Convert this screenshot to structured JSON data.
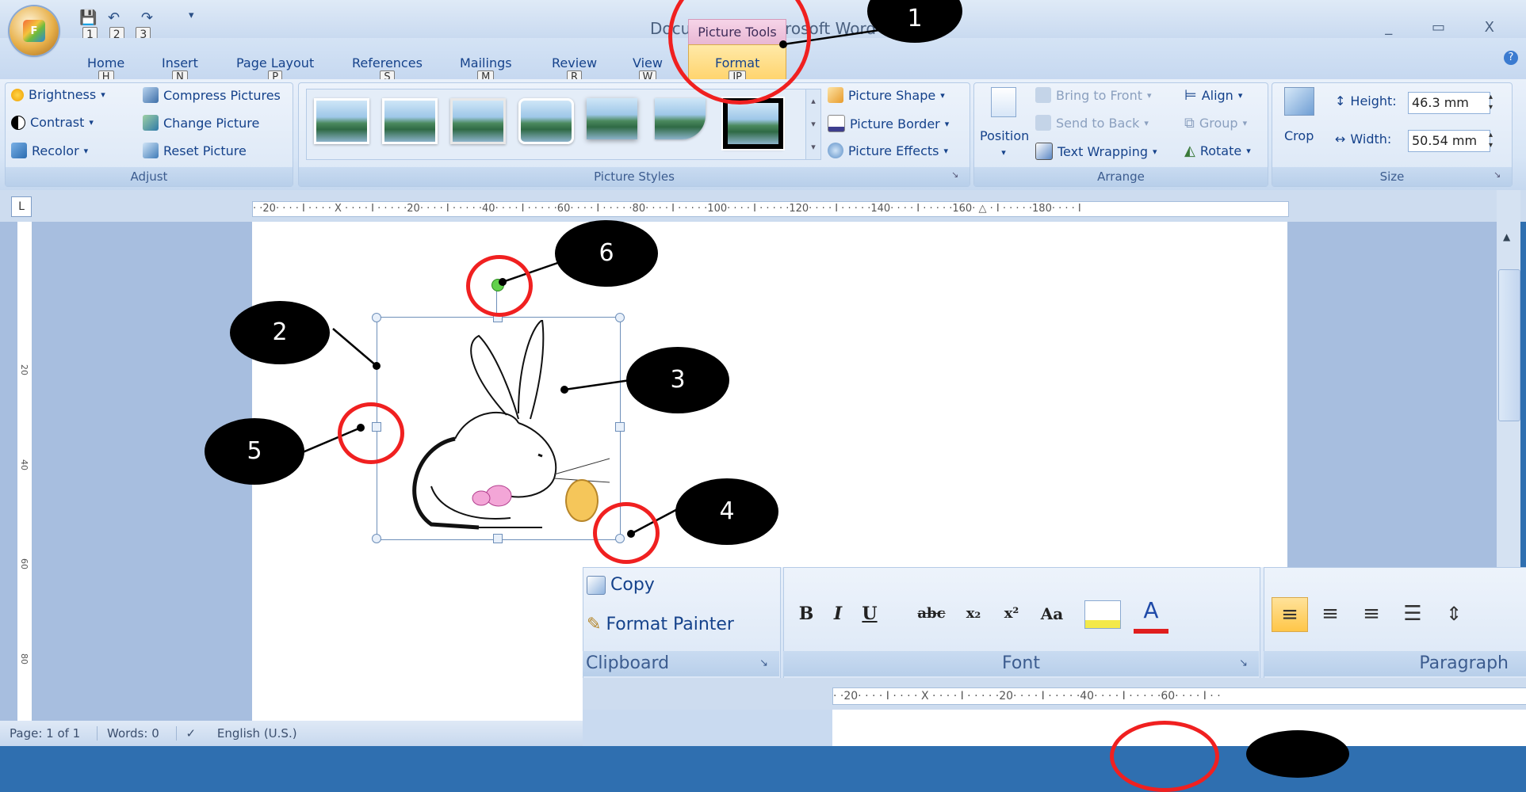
{
  "window": {
    "title": "Document1 - Microsoft Word",
    "controls": "_ ▭ X"
  },
  "office_button": {
    "logo": "F"
  },
  "qat": {
    "keytips": [
      "1",
      "2",
      "3"
    ]
  },
  "tabs": [
    {
      "label": "Home",
      "key": "H"
    },
    {
      "label": "Insert",
      "key": "N"
    },
    {
      "label": "Page Layout",
      "key": "P"
    },
    {
      "label": "References",
      "key": "S"
    },
    {
      "label": "Mailings",
      "key": "M"
    },
    {
      "label": "Review",
      "key": "R"
    },
    {
      "label": "View",
      "key": "W"
    },
    {
      "label": "Format",
      "key": "JP"
    }
  ],
  "contextual_tab": "Picture Tools",
  "ribbon": {
    "adjust": {
      "label": "Adjust",
      "brightness": "Brightness",
      "contrast": "Contrast",
      "recolor": "Recolor",
      "compress": "Compress Pictures",
      "change": "Change Picture",
      "reset": "Reset Picture"
    },
    "picture_styles": {
      "label": "Picture Styles",
      "shape": "Picture Shape",
      "border": "Picture Border",
      "effects": "Picture Effects"
    },
    "arrange": {
      "label": "Arrange",
      "position": "Position",
      "bring_front": "Bring to Front",
      "send_back": "Send to Back",
      "text_wrap": "Text Wrapping",
      "align": "Align",
      "group": "Group",
      "rotate": "Rotate"
    },
    "size": {
      "label": "Size",
      "crop": "Crop",
      "height_label": "Height:",
      "height_value": "46.3 mm",
      "width_label": "Width:",
      "width_value": "50.54 mm"
    }
  },
  "ruler": {
    "ticks": "· ·20· · · · I · · · · X · · · · I · · · · ·20· · · · I · · · · ·40· · · · I · · · · ·60· · · · I · · · · ·80· · · · I · · · · ·100· · · · I · · · · ·120· · · · I · · · · ·140· · · · I · · · · ·160· △ · I · · · · ·180· · · · I",
    "tab_selector": "L"
  },
  "vruler": {
    "labels": [
      "20",
      "40",
      "60",
      "80"
    ]
  },
  "status": {
    "page": "Page: 1 of 1",
    "words": "Words: 0",
    "language": "English (U.S.)"
  },
  "inset": {
    "copy": "Copy",
    "format_painter": "Format Painter",
    "clipboard": "Clipboard",
    "font": "Font",
    "paragraph": "Paragraph",
    "font_buttons": [
      "B",
      "I",
      "U",
      "abc",
      "x₂",
      "x²",
      "Aa"
    ],
    "ruler": "· ·20· · · · I · · · · X · · · · I · · · · ·20· · · · I · · · · ·40· · · · I · · · · ·60· · · · I · ·"
  },
  "callouts": [
    "1",
    "2",
    "3",
    "4",
    "5",
    "6"
  ]
}
